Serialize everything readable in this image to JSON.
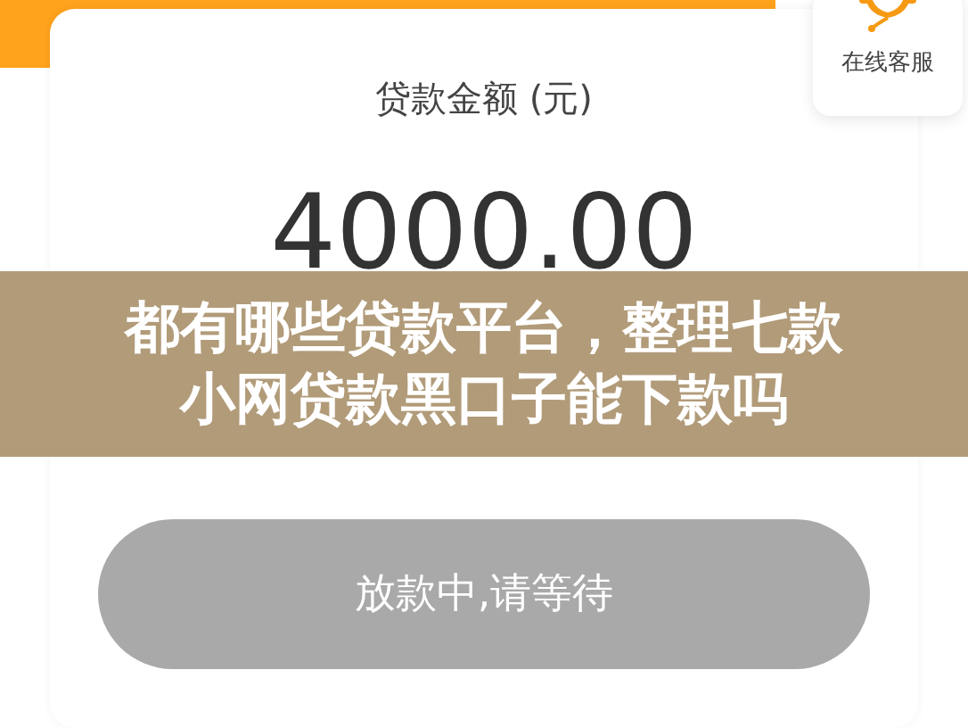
{
  "service": {
    "label": "在线客服"
  },
  "amount": {
    "label": "贷款金额 (元)",
    "value": "4000.00"
  },
  "banner": {
    "lines": [
      "都有哪些贷款平台，整理七款",
      "小网贷款黑口子能下款吗"
    ]
  },
  "action_button": {
    "label": "放款中,请等待",
    "disabled": true
  }
}
